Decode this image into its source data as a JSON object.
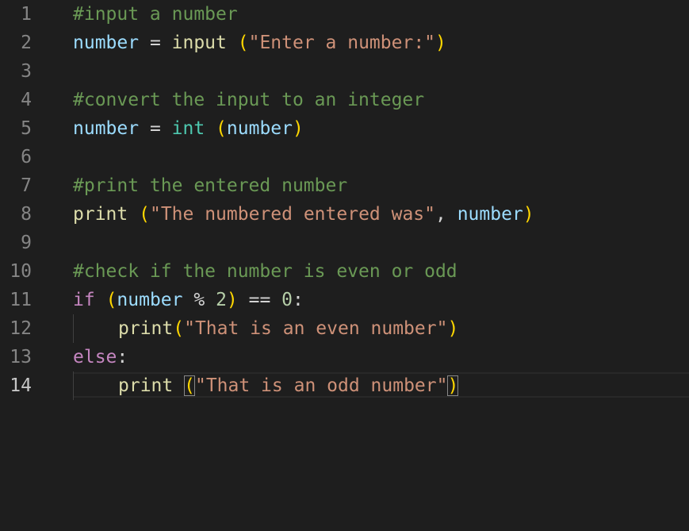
{
  "editor": {
    "lines": [
      {
        "number": "1",
        "tokens": [
          "#input a number"
        ]
      },
      {
        "number": "2",
        "tokens": [
          "number",
          " = ",
          "input",
          " ",
          "(",
          "\"Enter a number:\"",
          ")"
        ]
      },
      {
        "number": "3",
        "tokens": []
      },
      {
        "number": "4",
        "tokens": [
          "#convert the input to an integer"
        ]
      },
      {
        "number": "5",
        "tokens": [
          "number",
          " = ",
          "int",
          " ",
          "(",
          "number",
          ")"
        ]
      },
      {
        "number": "6",
        "tokens": []
      },
      {
        "number": "7",
        "tokens": [
          "#print the entered number"
        ]
      },
      {
        "number": "8",
        "tokens": [
          "print",
          " ",
          "(",
          "\"The numbered entered was\"",
          ", ",
          "number",
          ")"
        ]
      },
      {
        "number": "9",
        "tokens": []
      },
      {
        "number": "10",
        "tokens": [
          "#check if the number is even or odd"
        ]
      },
      {
        "number": "11",
        "tokens": [
          "if",
          " ",
          "(",
          "number",
          " % ",
          "2",
          ")",
          " == ",
          "0",
          ":"
        ]
      },
      {
        "number": "12",
        "tokens": [
          "print",
          "(",
          "\"That is an even number\"",
          ")"
        ]
      },
      {
        "number": "13",
        "tokens": [
          "else",
          ":"
        ]
      },
      {
        "number": "14",
        "tokens": [
          "print",
          " ",
          "(",
          "\"That is an odd number\"",
          ")"
        ]
      }
    ]
  },
  "colors": {
    "background": "#1e1e1e",
    "comment": "#6a9955",
    "variable": "#9cdcfe",
    "function": "#dcdcaa",
    "string": "#ce9178",
    "number": "#b5cea8",
    "keyword": "#c586c0",
    "type": "#4ec9b0",
    "bracket": "#ffd700"
  }
}
